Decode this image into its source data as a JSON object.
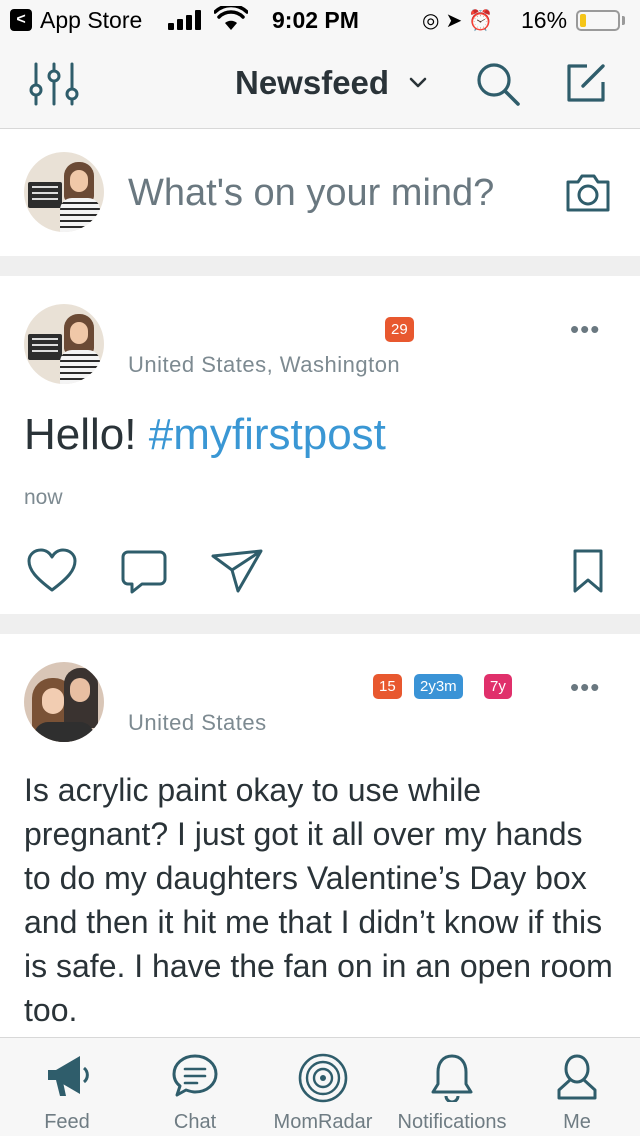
{
  "status_bar": {
    "back_glyph": "<",
    "back_app": "App Store",
    "time": "9:02 PM",
    "battery_percent": "16%",
    "battery_level": 0.16,
    "battery_color": "#f5c518",
    "icons": [
      "signal-icon",
      "wifi-icon",
      "orientation-lock-icon",
      "location-icon",
      "alarm-icon",
      "battery-icon"
    ]
  },
  "navbar": {
    "title": "Newsfeed",
    "icons": [
      "filter-sliders-icon",
      "chevron-down-icon",
      "search-icon",
      "compose-icon"
    ]
  },
  "composer": {
    "placeholder": "What's on your mind?",
    "icons": [
      "avatar",
      "camera-icon"
    ]
  },
  "posts": [
    {
      "location": "United States, Washington",
      "badges": [
        {
          "text": "29",
          "color": "#e8582f"
        }
      ],
      "text_plain": "Hello! ",
      "hashtag": "#myfirstpost",
      "time": "now",
      "actions": [
        "heart-icon",
        "comment-icon",
        "share-icon",
        "bookmark-icon"
      ]
    },
    {
      "location": "United States",
      "badges": [
        {
          "text": "15",
          "color": "#e8582f"
        },
        {
          "text": "2y3m",
          "color": "#3a93d6"
        },
        {
          "text": "7y",
          "color": "#e0306b"
        }
      ],
      "text": "Is acrylic paint okay to use while pregnant? I just got it all over my hands to do my daughters Valentine’s Day box and then it hit me that I didn’t know if this is safe. I have the fan on in an open room too."
    }
  ],
  "more_glyph": "•••",
  "tabbar": {
    "tabs": [
      {
        "label": "Feed",
        "icon": "megaphone-icon",
        "active": true
      },
      {
        "label": "Chat",
        "icon": "chat-bubble-icon"
      },
      {
        "label": "MomRadar",
        "icon": "radar-icon"
      },
      {
        "label": "Notifications",
        "icon": "bell-icon"
      },
      {
        "label": "Me",
        "icon": "person-icon"
      }
    ]
  },
  "colors": {
    "text_dark": "#2a3338",
    "text_muted": "#7d8a91",
    "hashtag": "#3a97d4",
    "divider": "#efefef"
  }
}
